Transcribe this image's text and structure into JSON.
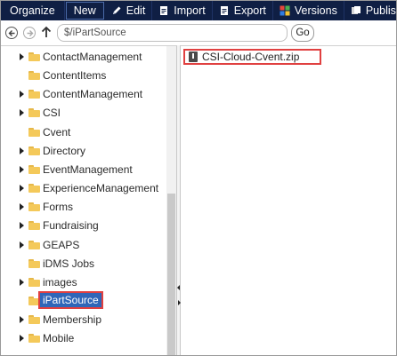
{
  "toolbar": {
    "organize": "Organize",
    "new": "New",
    "edit": "Edit",
    "import": "Import",
    "export": "Export",
    "versions": "Versions",
    "publish": "Publish"
  },
  "address": {
    "path": "$/iPartSource",
    "go": "Go"
  },
  "tree": [
    {
      "label": "ContactManagement",
      "expandable": true
    },
    {
      "label": "ContentItems",
      "expandable": false
    },
    {
      "label": "ContentManagement",
      "expandable": true
    },
    {
      "label": "CSI",
      "expandable": true
    },
    {
      "label": "Cvent",
      "expandable": false
    },
    {
      "label": "Directory",
      "expandable": true
    },
    {
      "label": "EventManagement",
      "expandable": true
    },
    {
      "label": "ExperienceManagement",
      "expandable": true
    },
    {
      "label": "Forms",
      "expandable": true
    },
    {
      "label": "Fundraising",
      "expandable": true
    },
    {
      "label": "GEAPS",
      "expandable": true
    },
    {
      "label": "iDMS Jobs",
      "expandable": false
    },
    {
      "label": "images",
      "expandable": true
    },
    {
      "label": "iPartSource",
      "expandable": false,
      "selected": true
    },
    {
      "label": "Membership",
      "expandable": true
    },
    {
      "label": "Mobile",
      "expandable": true
    }
  ],
  "files": [
    {
      "name": "CSI-Cloud-Cvent.zip",
      "icon": "zip-file-icon"
    }
  ],
  "colors": {
    "toolbar_bg": "#0f1f44",
    "selection_bg": "#2f66b8",
    "highlight_border": "#e04040",
    "folder": "#f4c95a"
  }
}
